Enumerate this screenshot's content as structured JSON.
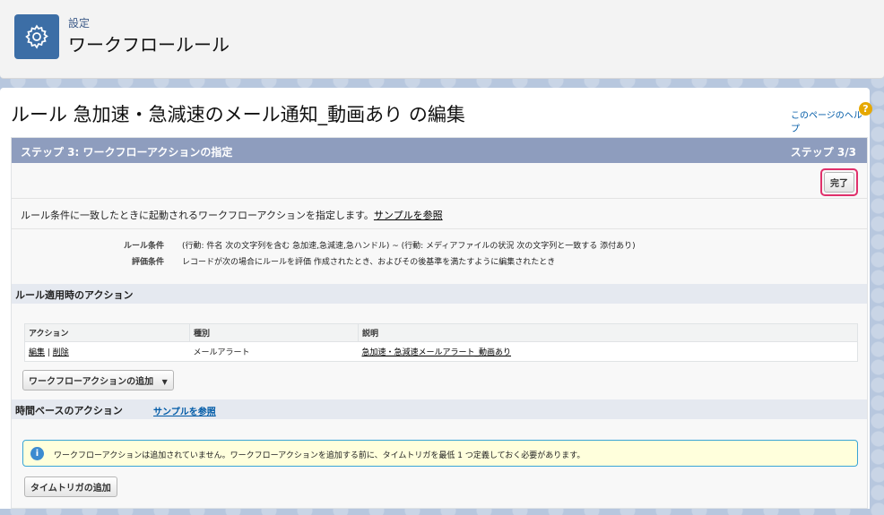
{
  "header": {
    "subtitle": "設定",
    "title": "ワークフロールール",
    "icon": "gear-icon"
  },
  "page": {
    "title": "ルール 急加速・急減速のメール通知_動画あり の編集",
    "help_link": "このページのヘルプ",
    "help_icon": "?"
  },
  "step_bar": {
    "title": "ステップ 3: ワークフローアクションの指定",
    "step": "ステップ 3/3"
  },
  "buttons": {
    "done": "完了",
    "add_workflow_action": "ワークフローアクションの追加",
    "add_time_trigger": "タイムトリガの追加"
  },
  "description": {
    "text": "ルール条件に一致したときに起動されるワークフローアクションを指定します。",
    "link": "サンプルを参照"
  },
  "rule": {
    "criteria_label": "ルール条件",
    "criteria_value": "(行動: 件名 次の文字列を含む 急加速,急減速,急ハンドル) ~ (行動: メディアファイルの状況 次の文字列と一致する 添付あり)",
    "eval_label": "評価条件",
    "eval_value": "レコードが次の場合にルールを評価 作成されたとき、およびその後基準を満たすように編集されたとき"
  },
  "immediate_section": {
    "title": "ルール適用時のアクション"
  },
  "actions_table": {
    "headers": [
      "アクション",
      "種別",
      "説明"
    ],
    "rows": [
      {
        "edit": "編集",
        "sep": " | ",
        "delete": "削除",
        "type": "メールアラート",
        "description": "急加速・急減速メールアラート_動画あり"
      }
    ]
  },
  "time_section": {
    "title": "時間ベースのアクション",
    "link": "サンプルを参照"
  },
  "info": {
    "icon": "i",
    "text": "ワークフローアクションは追加されていません。ワークフローアクションを追加する前に、タイムトリガを最低 1 つ定義しておく必要があります。"
  },
  "colors": {
    "step_bar": "#8e9dbe",
    "highlight": "#e0306b",
    "info_bg": "#ffffdc",
    "info_border": "#39a5d5"
  }
}
